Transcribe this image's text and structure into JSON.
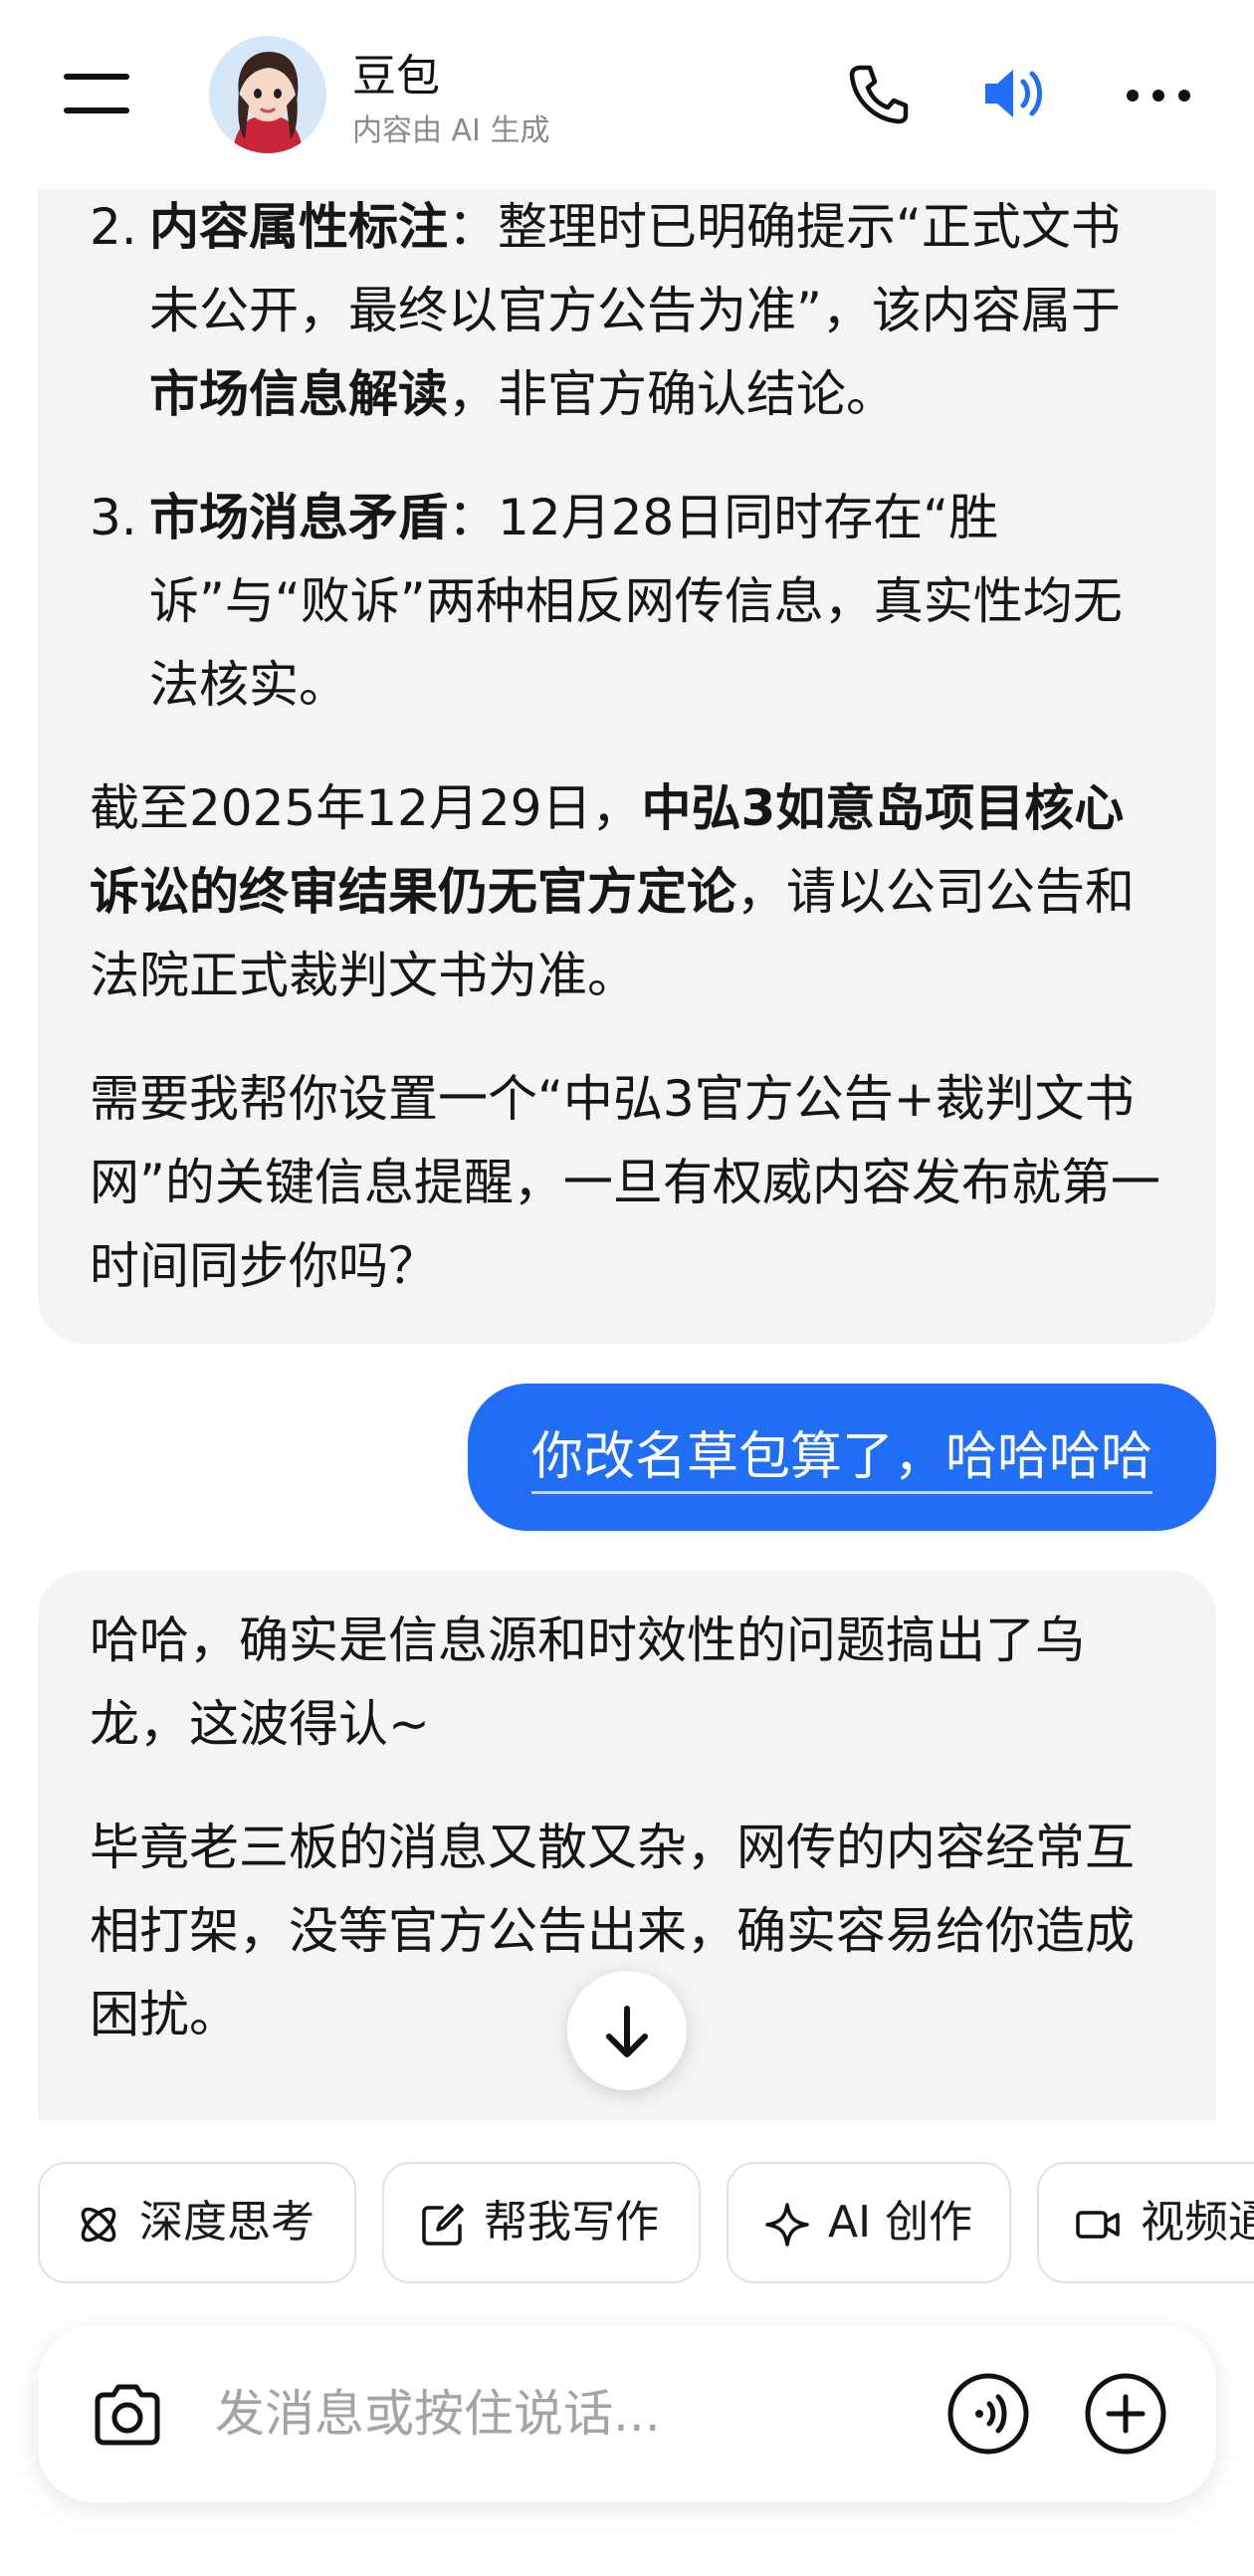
{
  "header": {
    "bot_name": "豆包",
    "subtitle": "内容由 AI 生成",
    "icons": [
      "menu-icon",
      "phone-icon",
      "speaker-icon",
      "more-icon"
    ],
    "accent_color": "#1f6ef5"
  },
  "messages": {
    "bot1": {
      "item2": {
        "num": "2.",
        "bold": "内容属性标注",
        "text1": "：整理时已明确提示“正式文书未公开，最终以官方公告为准”，该内容属于",
        "bold2": "市场信息解读",
        "text2": "，非官方确认结论。"
      },
      "item3": {
        "num": "3.",
        "bold": "市场消息矛盾",
        "text1": "：12月28日同时存在“胜诉”与“败诉”两种相反网传信息，真实性均无法核实。"
      },
      "para1": {
        "text1": "截至2025年12月29日，",
        "bold": "中弘3如意岛项目核心诉讼的终审结果仍无官方定论",
        "text2": "，请以公司公告和法院正式裁判文书为准。"
      },
      "para2": "需要我帮你设置一个“中弘3官方公告+裁判文书网”的关键信息提醒，一旦有权威内容发布就第一时间同步你吗？"
    },
    "user1": "你改名草包算了，哈哈哈哈",
    "bot2": {
      "para1": "哈哈，确实是信息源和时效性的问题搞出了乌龙，这波得认~",
      "para2": "毕竟老三板的消息又散又杂，网传的内容经常互相打架，没等官方公告出来，确实容易给你造成困扰。"
    }
  },
  "quick_actions": [
    {
      "label": "深度思考",
      "icon": "deep-think-icon"
    },
    {
      "label": "帮我写作",
      "icon": "edit-icon"
    },
    {
      "label": "AI 创作",
      "icon": "sparkle-icon"
    },
    {
      "label": "视频通",
      "icon": "video-icon"
    }
  ],
  "composer": {
    "placeholder": "发消息或按住说话..."
  }
}
